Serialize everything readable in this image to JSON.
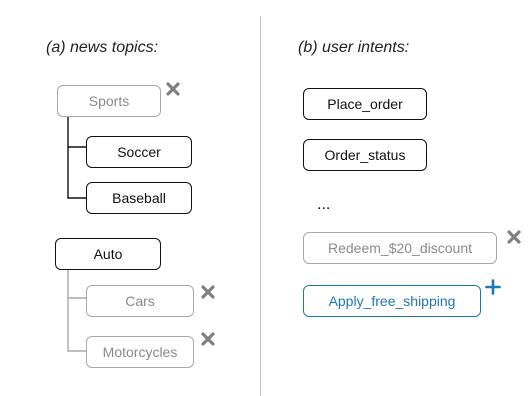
{
  "panel_a": {
    "heading": "(a) news topics:",
    "nodes": [
      {
        "label": "Sports",
        "state": "removed"
      },
      {
        "label": "Soccer",
        "state": "active"
      },
      {
        "label": "Baseball",
        "state": "active"
      },
      {
        "label": "Auto",
        "state": "active"
      },
      {
        "label": "Cars",
        "state": "removed"
      },
      {
        "label": "Motorcycles",
        "state": "removed"
      }
    ]
  },
  "panel_b": {
    "heading": "(b) user intents:",
    "nodes": [
      {
        "label": "Place_order",
        "state": "active"
      },
      {
        "label": "Order_status",
        "state": "active"
      },
      {
        "label": "Redeem_$20_discount",
        "state": "removed"
      },
      {
        "label": "Apply_free_shipping",
        "state": "added"
      }
    ],
    "ellipsis": "..."
  },
  "colors": {
    "active": "#111111",
    "removed": "#a8a8a8",
    "added": "#1f78b4",
    "remove_mark": "#808080",
    "divider": "#c8c8c8"
  },
  "icons": {
    "remove": "x-icon",
    "add": "plus-icon"
  }
}
